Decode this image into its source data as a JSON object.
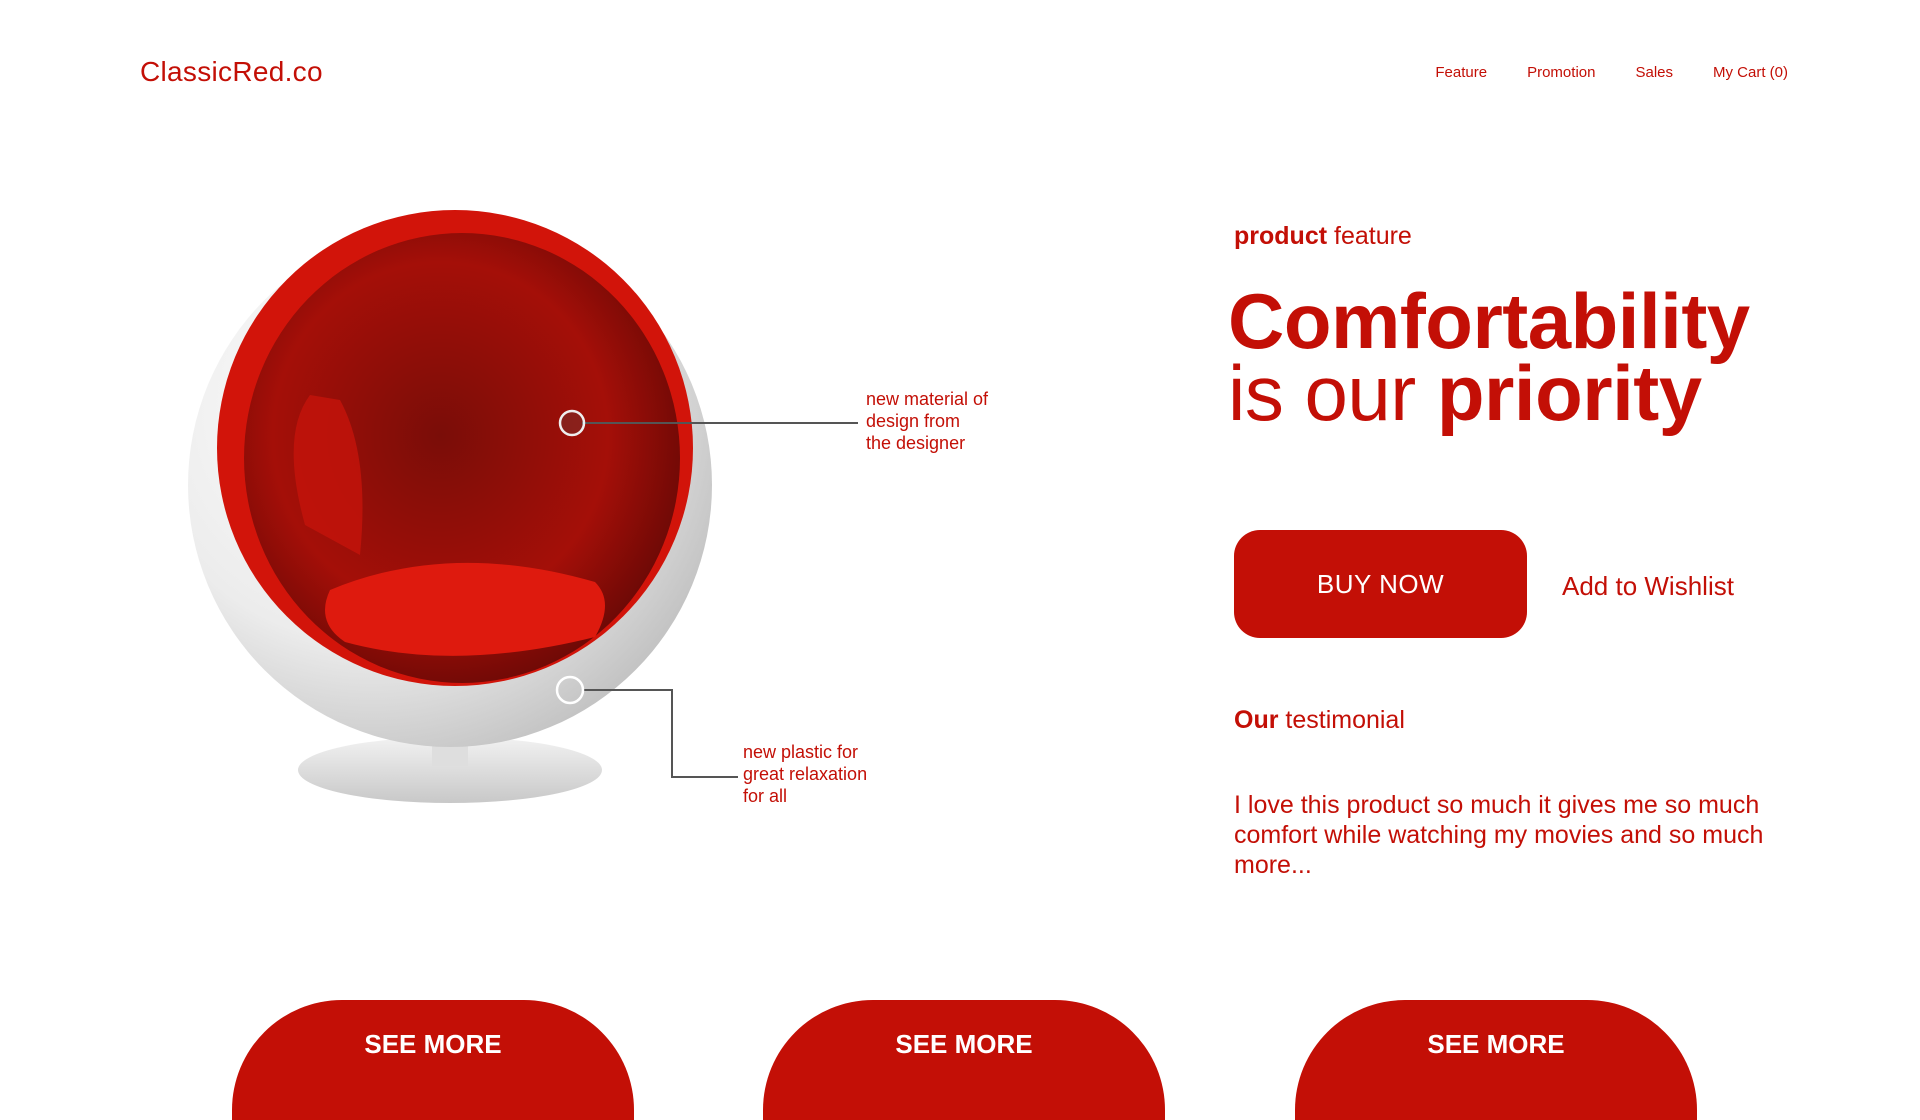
{
  "header": {
    "logo": "ClassicRed.co",
    "nav": [
      "Feature",
      "Promotion",
      "Sales",
      "My Cart (0)"
    ]
  },
  "product": {
    "eyebrow_bold": "product",
    "eyebrow_rest": " feature",
    "headline_line1": "Comfortability",
    "headline_line2_light": "is our ",
    "headline_line2_bold": "priority",
    "buy_label": "BUY NOW",
    "wishlist_label": "Add to Wishlist"
  },
  "callouts": [
    {
      "text": "new material of\ndesign from\nthe designer"
    },
    {
      "text": "new plastic for\ngreat relaxation\nfor all"
    }
  ],
  "testimonial": {
    "heading_bold": "Our",
    "heading_rest": " testimonial",
    "text": "I love this product so much it gives me so much comfort while watching my movies and so much more..."
  },
  "cards": [
    {
      "label": "SEE MORE"
    },
    {
      "label": "SEE MORE"
    },
    {
      "label": "SEE MORE"
    }
  ],
  "colors": {
    "accent": "#c30f06",
    "background": "#ffffff"
  },
  "image": {
    "alt": "red egg ball chair"
  }
}
